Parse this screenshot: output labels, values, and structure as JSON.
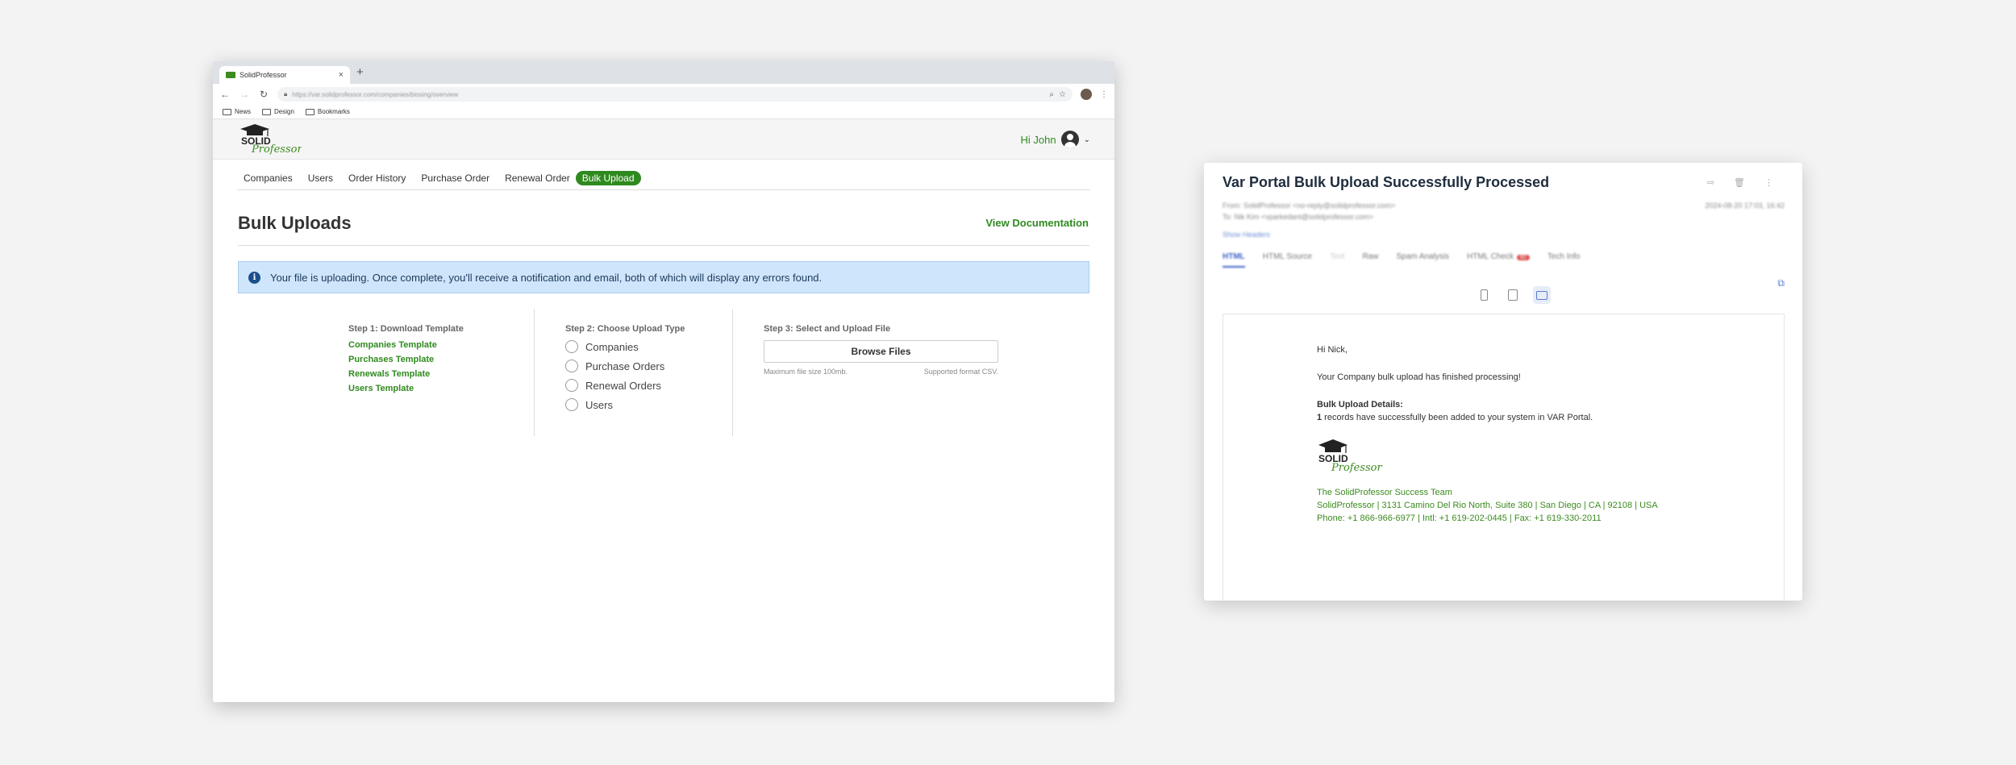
{
  "browser": {
    "tab_title": "SolidProfessor",
    "tab_close": "×",
    "new_tab": "+",
    "url": "https://var.solidprofessor.com/companies/biosing/overview",
    "bookmarks": [
      "News",
      "Design",
      "Bookmarks"
    ]
  },
  "site": {
    "logo_text": "SOLID Professor",
    "greeting": "Hi John",
    "nav": [
      "Companies",
      "Users",
      "Order History",
      "Purchase Order",
      "Renewal Order",
      "Bulk Upload"
    ],
    "page_title": "Bulk Uploads",
    "view_documentation": "View Documentation",
    "info_message": "Your file is uploading. Once complete, you'll receive a notification and email, both of which will display any errors found.",
    "step1": {
      "heading": "Step 1: Download Template",
      "templates": [
        "Companies Template",
        "Purchases Template",
        "Renewals Template",
        "Users Template"
      ]
    },
    "step2": {
      "heading": "Step 2: Choose Upload Type",
      "options": [
        "Companies",
        "Purchase Orders",
        "Renewal Orders",
        "Users"
      ]
    },
    "step3": {
      "heading": "Step 3: Select and Upload File",
      "button": "Browse Files",
      "max_size": "Maximum file size 100mb.",
      "format": "Supported format CSV."
    }
  },
  "mail": {
    "subject": "Var Portal Bulk Upload Successfully Processed",
    "from": "From: SolidProfessor <no-reply@solidprofessor.com>",
    "to": "To: Nik Kim <vparkedant@solidprofessor.com>",
    "date": "2024-08-20 17:03, 16:42",
    "show_headers": "Show Headers",
    "tabs": [
      "HTML",
      "HTML Source",
      "Text",
      "Raw",
      "Spam Analysis",
      "HTML Check",
      "Tech Info"
    ],
    "html_check_badge": "82",
    "body": {
      "greeting": "Hi Nick,",
      "line1": "Your Company bulk upload has finished processing!",
      "details_heading": "Bulk Upload Details:",
      "records_count": "1",
      "records_text": " records have successfully been added to your system in VAR Portal.",
      "team": "The SolidProfessor Success Team",
      "address": "SolidProfessor | 3131 Camino Del Rio North, Suite 380 | San Diego | CA | 92108 | USA",
      "phone": "Phone: +1 866-966-6977 | Intl: +1 619-202-0445 | Fax: +1 619-330-2011"
    }
  },
  "colors": {
    "brand_green": "#2f8a1e",
    "info_bg": "#cfe5fb",
    "mail_accent": "#3d63c9"
  }
}
